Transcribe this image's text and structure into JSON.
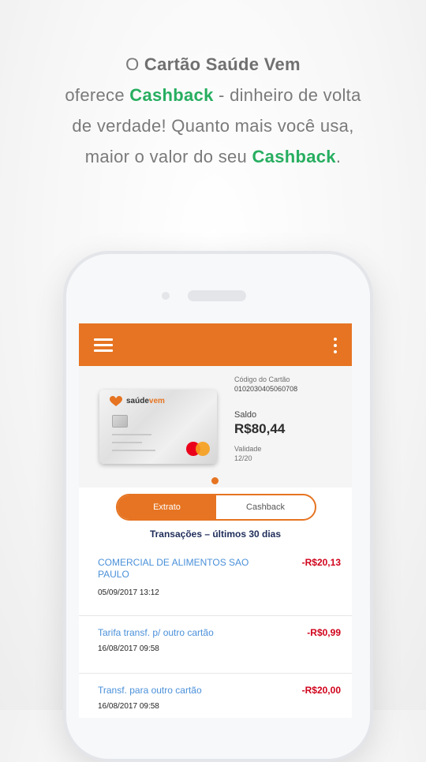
{
  "headline": {
    "p1": "O ",
    "brand": "Cartão Saúde Vem",
    "p2": "oferece ",
    "cashback1": "Cashback",
    "p3": " - dinheiro de volta",
    "p4": "de verdade! Quanto mais você usa,",
    "p5": "maior o valor do seu ",
    "cashback2": "Cashback",
    "p6": "."
  },
  "app": {
    "accent": "#e67422",
    "menu_icon": "hamburger-menu-icon",
    "more_icon": "more-vertical-icon"
  },
  "card": {
    "logo_text_a": "saúde",
    "logo_text_b": "vem",
    "code_label": "Código do Cartão",
    "code_value": "0102030405060708",
    "balance_label": "Saldo",
    "balance_value": "R$80,44",
    "validity_label": "Validade",
    "validity_value": "12/20"
  },
  "tabs": [
    {
      "label": "Extrato",
      "active": true
    },
    {
      "label": "Cashback",
      "active": false
    }
  ],
  "transactions_title": "Transações – últimos 30 dias",
  "transactions": [
    {
      "name": "COMERCIAL DE ALIMENTOS SAO PAULO",
      "amount": "-R$20,13",
      "date": "05/09/2017 13:12"
    },
    {
      "name": "Tarifa transf. p/ outro cartão",
      "amount": "-R$0,99",
      "date": "16/08/2017 09:58"
    },
    {
      "name": "Transf. para outro cartão",
      "amount": "-R$20,00",
      "date": "16/08/2017 09:58"
    }
  ]
}
